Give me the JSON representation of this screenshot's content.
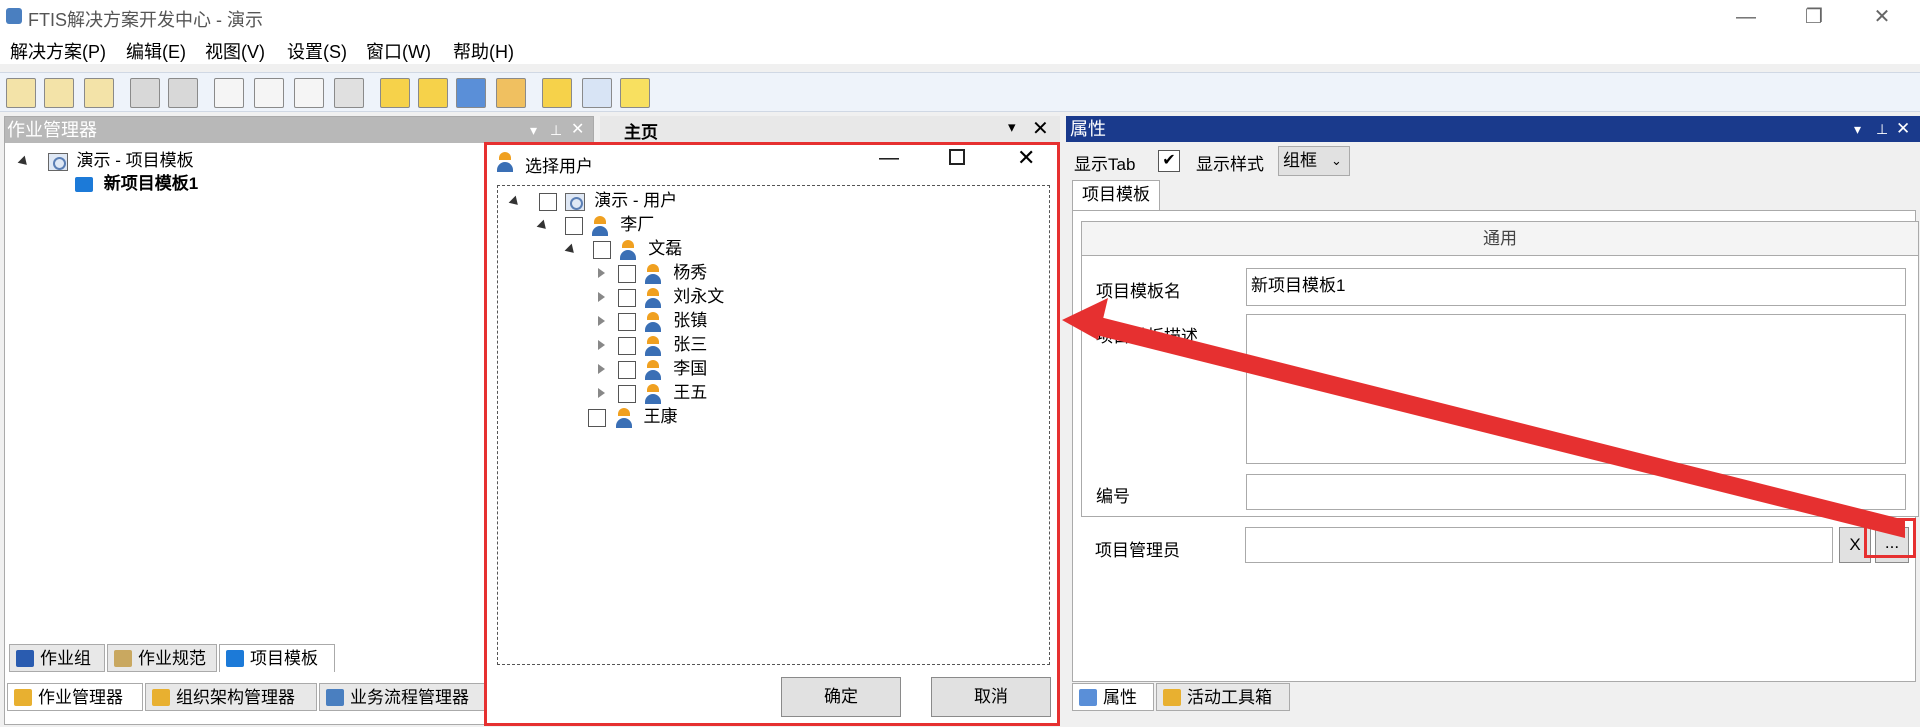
{
  "window": {
    "title": "FTIS解决方案开发中心 - 演示",
    "min": "—",
    "restore": "❐",
    "close": "✕"
  },
  "menu": [
    "解决方案(P)",
    "编辑(E)",
    "视图(V)",
    "设置(S)",
    "窗口(W)",
    "帮助(H)"
  ],
  "left_panel": {
    "title": "作业管理器",
    "tree_root": "演示 - 项目模板",
    "tree_child": "新项目模板1",
    "bottom_tabs": [
      "作业组",
      "作业规范",
      "项目模板"
    ],
    "manager_tabs": [
      "作业管理器",
      "组织架构管理器",
      "业务流程管理器"
    ]
  },
  "main_tab": "主页",
  "dialog": {
    "title": "选择用户",
    "root": "演示 - 用户",
    "level1": "李厂",
    "level2": "文磊",
    "children": [
      "杨秀",
      "刘永文",
      "张镇",
      "张三",
      "李国",
      "王五"
    ],
    "sibling": "王康",
    "ok": "确定",
    "cancel": "取消"
  },
  "properties": {
    "title": "属性",
    "show_tab": "显示Tab",
    "show_style": "显示样式",
    "style_value": "组框",
    "tab_label": "项目模板",
    "group_title": "通用",
    "fields": {
      "name_label": "项目模板名",
      "name_value": "新项目模板1",
      "desc_label": "项目模板描述",
      "code_label": "编号",
      "manager_label": "项目管理员"
    },
    "clear_btn": "X",
    "browse_btn": "...",
    "bottom_tabs": [
      "属性",
      "活动工具箱"
    ]
  },
  "colors": {
    "highlight": "#e63030",
    "panel_header": "#1a3a8c"
  }
}
